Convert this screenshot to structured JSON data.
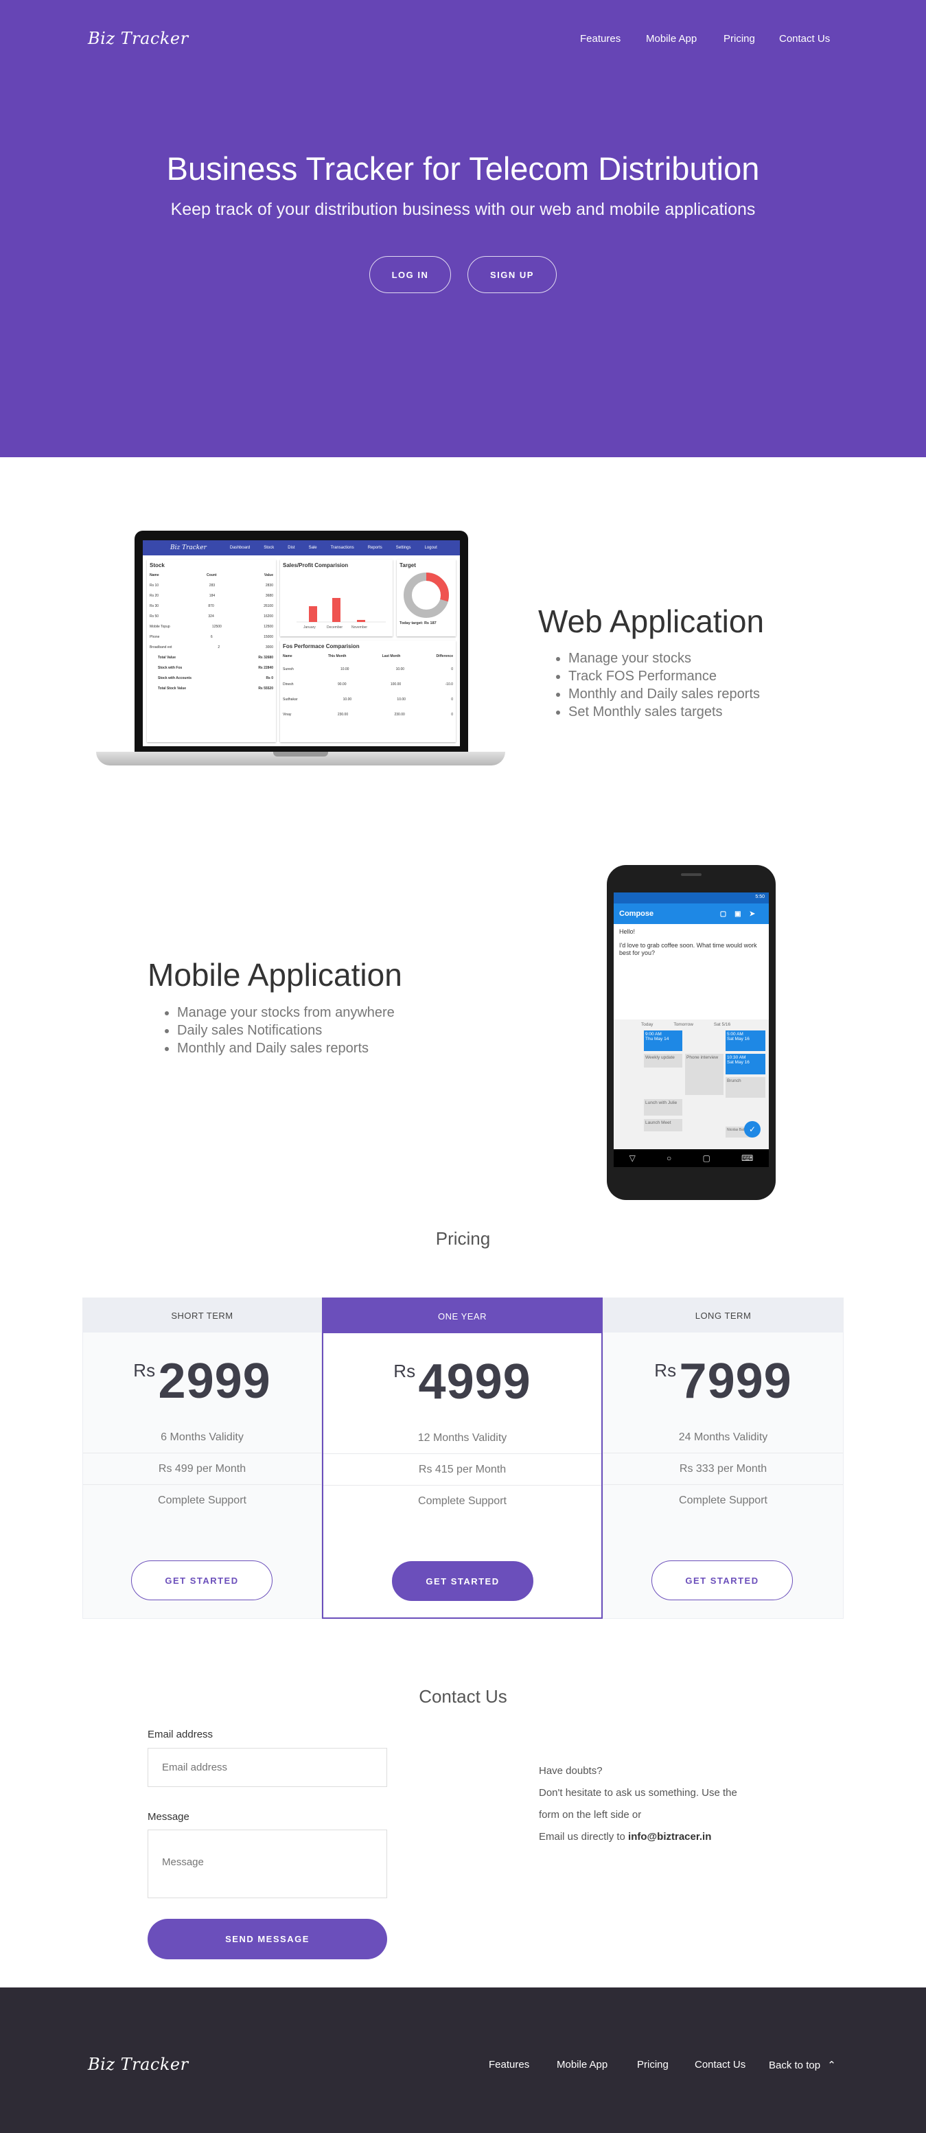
{
  "header": {
    "brand": "Biz Tracker",
    "nav": [
      "Features",
      "Mobile App",
      "Pricing",
      "Contact Us"
    ]
  },
  "hero": {
    "title": "Business Tracker for Telecom Distribution",
    "subtitle": "Keep track of your distribution business with our web and mobile applications",
    "login_label": "LOG IN",
    "signup_label": "SIGN UP"
  },
  "web_app": {
    "title": "Web Application",
    "features": [
      "Manage your stocks",
      "Track FOS Performance",
      "Monthly and Daily sales reports",
      "Set Monthly sales targets"
    ],
    "screenshot": {
      "brand": "Biz Tracker",
      "nav": [
        "Dashboard",
        "Stock",
        "Dist",
        "Sale",
        "Transactions",
        "Reports",
        "Settings",
        "Logout"
      ],
      "stock_title": "Stock",
      "stock_headers": [
        "Name",
        "Count",
        "Value"
      ],
      "stock_rows": [
        [
          "Rs 10",
          "283",
          "2830"
        ],
        [
          "Rs 20",
          "184",
          "3680"
        ],
        [
          "Rs 30",
          "870",
          "26100"
        ],
        [
          "Rs 50",
          "324",
          "16200"
        ],
        [
          "Mobile Topup",
          "12500",
          "12500"
        ],
        [
          "Phone",
          "6",
          "15000"
        ],
        [
          "Broadband ext",
          "2",
          "3000"
        ]
      ],
      "stock_totals": [
        [
          "Total Value",
          "Rs 32680"
        ],
        [
          "Stock with Fos",
          "Rs 22840"
        ],
        [
          "Stock with Accounts",
          "Rs 0"
        ],
        [
          "Total Stock Value",
          "Rs 55520"
        ]
      ],
      "sales_title": "Sales/Profit Comparision",
      "sales_bar_labels": [
        "January",
        "December",
        "November"
      ],
      "target_title": "Target",
      "target_text": "Today target: Rs 187",
      "fos_title": "Fos Performace Comparision",
      "fos_headers": [
        "Name",
        "This Month",
        "Last Month",
        "Difference"
      ],
      "fos_rows": [
        [
          "Suresh",
          "10.00",
          "10.00",
          "0"
        ],
        [
          "Dinesh",
          "90.00",
          "100.00",
          "-10.0"
        ],
        [
          "Sudhakar",
          "10.00",
          "10.00",
          "0"
        ],
        [
          "Vinay",
          "230.00",
          "230.00",
          "0"
        ]
      ]
    }
  },
  "mobile_app": {
    "title": "Mobile Application",
    "features": [
      "Manage your stocks from anywhere",
      "Daily sales Notifications",
      "Monthly and Daily sales reports"
    ],
    "phone": {
      "status_time": "5:50",
      "compose_title": "Compose",
      "greeting": "Hello!",
      "message": "I'd love to grab coffee soon. What time would work best for you?",
      "days": [
        "Today",
        "Tomorrow",
        "Sat 5/16"
      ],
      "slot_a": "9:00 AM",
      "slot_a_date": "Thu May 14",
      "slot_b": "5:00 AM",
      "slot_b_date": "Sat May 16",
      "slot_c": "10:30 AM",
      "slot_c_date": "Sat May 16",
      "event_1": "Weekly update",
      "event_2": "Phone interview",
      "event_3": "Brunch",
      "event_4": "Lunch with Julie",
      "event_5": "Launch Meet",
      "event_6": "Nicolas Ball"
    }
  },
  "pricing": {
    "title": "Pricing",
    "currency": "Rs",
    "plans": [
      {
        "name": "SHORT TERM",
        "price": "2999",
        "validity": "6 Months Validity",
        "monthly": "Rs 499 per Month",
        "support": "Complete Support",
        "cta": "GET STARTED"
      },
      {
        "name": "ONE YEAR",
        "price": "4999",
        "validity": "12 Months Validity",
        "monthly": "Rs 415 per Month",
        "support": "Complete Support",
        "cta": "GET STARTED"
      },
      {
        "name": "LONG TERM",
        "price": "7999",
        "validity": "24 Months Validity",
        "monthly": "Rs 333 per Month",
        "support": "Complete Support",
        "cta": "GET STARTED"
      }
    ],
    "highlight_color": "#6b4fbb"
  },
  "contact": {
    "title": "Contact Us",
    "email_label": "Email address",
    "email_placeholder": "Email address",
    "message_label": "Message",
    "message_placeholder": "Message",
    "send_label": "SEND MESSAGE",
    "doubts_title": "Have doubts?",
    "doubts_line1": "Don't hesitate to ask us something. Use the",
    "doubts_line2": "form on the left side or",
    "doubts_line3": "Email us directly to",
    "email": "info@biztracer.in"
  },
  "footer": {
    "brand": "Biz Tracker",
    "nav": [
      "Features",
      "Mobile App",
      "Pricing",
      "Contact Us"
    ],
    "back_to_top": "Back to top"
  },
  "colors": {
    "primary": "#6645b5",
    "button": "#6b4fbb",
    "footer": "#2e2b35"
  }
}
